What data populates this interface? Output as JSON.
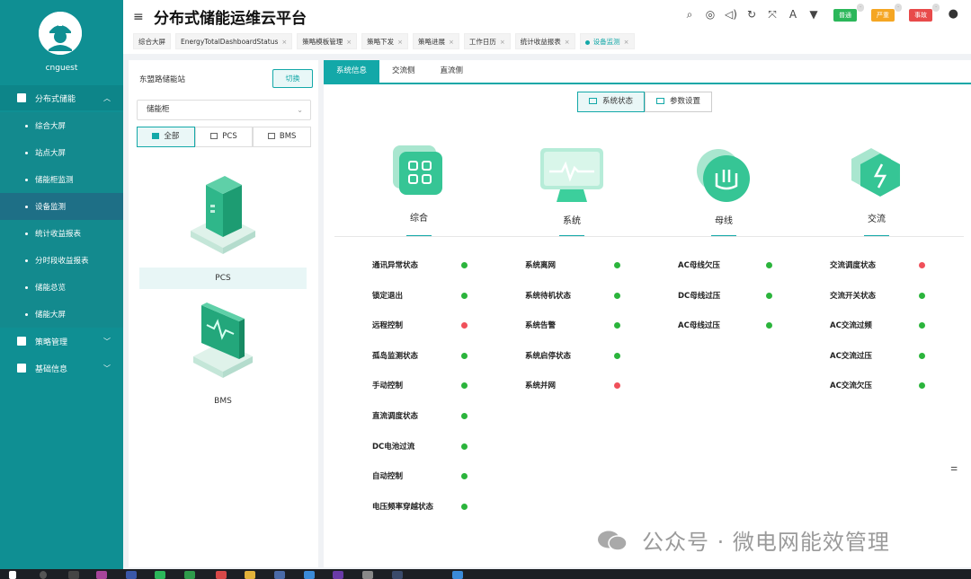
{
  "sidebar": {
    "username": "cnguest",
    "groups": [
      {
        "label": "分布式储能",
        "expanded": true
      },
      {
        "label": "策略管理",
        "expanded": false
      },
      {
        "label": "基础信息",
        "expanded": false
      }
    ],
    "items": [
      "综合大屏",
      "站点大屏",
      "储能柜监测",
      "设备监测",
      "统计收益报表",
      "分时段收益报表",
      "储能总览",
      "储能大屏"
    ],
    "active_item": "设备监测"
  },
  "header": {
    "title": "分布式储能运维云平台",
    "icons": [
      "search-icon",
      "help-icon",
      "volume-icon",
      "refresh-icon",
      "fullscreen-icon",
      "font-size-icon",
      "theme-icon"
    ],
    "badges": [
      {
        "label": "普通",
        "color": "#2bb75a"
      },
      {
        "label": "严重",
        "color": "#f5a623"
      },
      {
        "label": "事故",
        "color": "#e84a4a"
      }
    ],
    "tabs": [
      "综合大屏",
      "EnergyTotalDashboardStatus",
      "策略模板管理",
      "策略下发",
      "策略进展",
      "工作日历",
      "统计收益报表",
      "设备监测"
    ],
    "active_tab": "设备监测"
  },
  "left": {
    "station": "东盟路储能站",
    "switch_label": "切换",
    "select_value": "储能柜",
    "filters": [
      "全部",
      "PCS",
      "BMS"
    ],
    "devices": [
      "PCS",
      "BMS"
    ]
  },
  "right": {
    "tabs": [
      "系统信息",
      "交流侧",
      "直流侧"
    ],
    "toggles": [
      "系统状态",
      "参数设置"
    ],
    "categories": [
      "综合",
      "系统",
      "母线",
      "交流"
    ],
    "columns": [
      [
        {
          "label": "通讯异常状态",
          "status": "green"
        },
        {
          "label": "锁定退出",
          "status": "green"
        },
        {
          "label": "远程控制",
          "status": "red"
        },
        {
          "label": "孤岛监测状态",
          "status": "green"
        },
        {
          "label": "手动控制",
          "status": "green"
        },
        {
          "label": "直流调度状态",
          "status": "green"
        },
        {
          "label": "DC电池过流",
          "status": "green"
        },
        {
          "label": "自动控制",
          "status": "green"
        },
        {
          "label": "电压频率穿越状态",
          "status": "green"
        }
      ],
      [
        {
          "label": "系统离网",
          "status": "green"
        },
        {
          "label": "系统待机状态",
          "status": "green"
        },
        {
          "label": "系统告警",
          "status": "green"
        },
        {
          "label": "系统启停状态",
          "status": "green"
        },
        {
          "label": "系统并网",
          "status": "red"
        }
      ],
      [
        {
          "label": "AC母线欠压",
          "status": "green"
        },
        {
          "label": "DC母线过压",
          "status": "green"
        },
        {
          "label": "AC母线过压",
          "status": "green"
        }
      ],
      [
        {
          "label": "交流调度状态",
          "status": "red"
        },
        {
          "label": "交流开关状态",
          "status": "green"
        },
        {
          "label": "AC交流过频",
          "status": "green"
        },
        {
          "label": "AC交流过压",
          "status": "green"
        },
        {
          "label": "AC交流欠压",
          "status": "green"
        }
      ]
    ],
    "status_colors": {
      "green": "#2bb43c",
      "red": "#f0505a"
    }
  },
  "watermark": "公众号 · 微电网能效管理"
}
